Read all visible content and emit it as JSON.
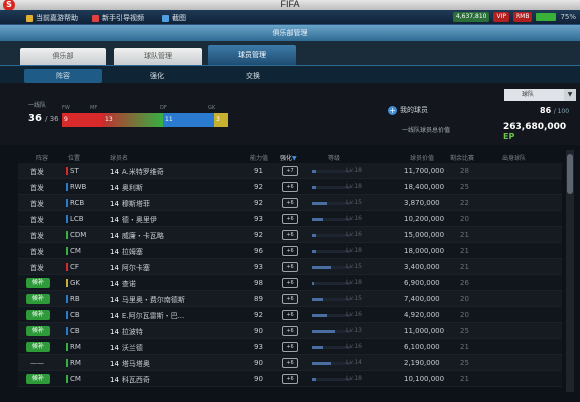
{
  "window": {
    "title": "FIFA"
  },
  "topbar": {
    "items": [
      {
        "label": "当前嘉游帮助",
        "icon": "help-icon"
      },
      {
        "label": "新手引导视频",
        "icon": "video-icon"
      },
      {
        "label": "截图",
        "icon": "screenshot-icon"
      }
    ],
    "status": {
      "ep": "4,637,810",
      "badge1": "VIP",
      "badge2": "RMB",
      "battery": "75%"
    }
  },
  "panel": {
    "title": "俱乐部管理"
  },
  "tabs": [
    "俱乐部",
    "球队管理",
    "球员管理"
  ],
  "subtabs": [
    "阵容",
    "强化",
    "交换"
  ],
  "summary": {
    "first_team_label": "一线队",
    "first_team_count": "36",
    "first_team_total": "/ 36",
    "positions": [
      {
        "label": "FW",
        "value": "9",
        "color": "#d82a2a"
      },
      {
        "label": "MF",
        "value": "13",
        "color": "#35b043"
      },
      {
        "label": "DF",
        "value": "11",
        "color": "#2a7ad0"
      },
      {
        "label": "GK",
        "value": "3",
        "color": "#c8b030"
      }
    ],
    "squad_select": "球队",
    "my_players_label": "我的球员",
    "player_count": "86",
    "player_max": "/ 100",
    "value_label": "一线队球员总价值",
    "value": "263,680,000",
    "value_unit": "EP"
  },
  "table": {
    "headers": [
      "阵容",
      "位置",
      "球员名",
      "能力值",
      "强化",
      "等级",
      "球员价值",
      "剩余比赛",
      "出身球队"
    ],
    "rows": [
      {
        "status": "首发",
        "pos": "ST",
        "color": "#d82a2a",
        "num": "14",
        "name": "A.米特罗维奇",
        "ovr": "91",
        "rank": "+7",
        "lv": "Lv.18",
        "price": "11,700,000",
        "age": "28",
        "club": "",
        "bar": 0.1
      },
      {
        "status": "首发",
        "pos": "RWB",
        "color": "#2a7ad0",
        "num": "14",
        "name": "奥利斯",
        "ovr": "92",
        "rank": "+6",
        "lv": "Lv.18",
        "price": "18,400,000",
        "age": "25",
        "club": "",
        "bar": 0.1
      },
      {
        "status": "首发",
        "pos": "RCB",
        "color": "#2a7ad0",
        "num": "14",
        "name": "穆斯塔菲",
        "ovr": "92",
        "rank": "+6",
        "lv": "Lv.15",
        "price": "3,870,000",
        "age": "22",
        "club": "",
        "bar": 0.4
      },
      {
        "status": "首发",
        "pos": "LCB",
        "color": "#2a7ad0",
        "num": "14",
        "name": "德・奥里伊",
        "ovr": "93",
        "rank": "+6",
        "lv": "Lv.16",
        "price": "10,200,000",
        "age": "20",
        "club": "",
        "bar": 0.3
      },
      {
        "status": "首发",
        "pos": "CDM",
        "color": "#35b043",
        "num": "14",
        "name": "威廉・卡瓦略",
        "ovr": "92",
        "rank": "+6",
        "lv": "Lv.16",
        "price": "15,000,000",
        "age": "21",
        "club": "",
        "bar": 0.1
      },
      {
        "status": "首发",
        "pos": "CM",
        "color": "#35b043",
        "num": "14",
        "name": "拉姆塞",
        "ovr": "96",
        "rank": "+6",
        "lv": "Lv.18",
        "price": "18,000,000",
        "age": "21",
        "club": "",
        "bar": 0.1
      },
      {
        "status": "首发",
        "pos": "CF",
        "color": "#d82a2a",
        "num": "14",
        "name": "阿尔卡塞",
        "ovr": "93",
        "rank": "+6",
        "lv": "Lv.15",
        "price": "3,400,000",
        "age": "21",
        "club": "",
        "bar": 0.5
      },
      {
        "status": "候补",
        "pos": "GK",
        "color": "#c8b030",
        "num": "14",
        "name": "查诺",
        "ovr": "98",
        "rank": "+6",
        "lv": "Lv.18",
        "price": "6,900,000",
        "age": "26",
        "club": "",
        "bar": 0.05
      },
      {
        "status": "候补",
        "pos": "RB",
        "color": "#2a7ad0",
        "num": "14",
        "name": "马里奥・费尔南德斯",
        "ovr": "89",
        "rank": "+6",
        "lv": "Lv.15",
        "price": "7,400,000",
        "age": "20",
        "club": "",
        "bar": 0.3
      },
      {
        "status": "候补",
        "pos": "CB",
        "color": "#2a7ad0",
        "num": "14",
        "name": "E.阿尔瓦雷斯・巴...",
        "ovr": "92",
        "rank": "+6",
        "lv": "Lv.16",
        "price": "4,920,000",
        "age": "20",
        "club": "",
        "bar": 0.4
      },
      {
        "status": "候补",
        "pos": "CB",
        "color": "#2a7ad0",
        "num": "14",
        "name": "拉波特",
        "ovr": "90",
        "rank": "+6",
        "lv": "Lv.13",
        "price": "11,000,000",
        "age": "25",
        "club": "",
        "bar": 0.6
      },
      {
        "status": "候补",
        "pos": "RM",
        "color": "#35b043",
        "num": "14",
        "name": "沃兰德",
        "ovr": "93",
        "rank": "+6",
        "lv": "Lv.16",
        "price": "6,100,000",
        "age": "21",
        "club": "",
        "bar": 0.3
      },
      {
        "status": "——",
        "pos": "RM",
        "color": "#35b043",
        "num": "14",
        "name": "塔马塔奥",
        "ovr": "90",
        "rank": "+6",
        "lv": "Lv.14",
        "price": "2,190,000",
        "age": "25",
        "club": "",
        "bar": 0.5
      },
      {
        "status": "候补",
        "pos": "CM",
        "color": "#35b043",
        "num": "14",
        "name": "科瓦西奇",
        "ovr": "90",
        "rank": "+6",
        "lv": "Lv.18",
        "price": "10,100,000",
        "age": "21",
        "club": "",
        "bar": 0.1
      }
    ]
  }
}
